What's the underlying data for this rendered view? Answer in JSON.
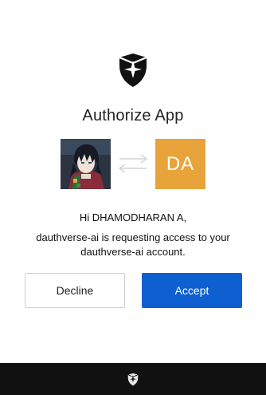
{
  "page": {
    "title": "Authorize App"
  },
  "app_avatar": {
    "icon": "anime-character-avatar"
  },
  "exchange_icon": "arrows-exchange-icon",
  "user_avatar": {
    "initials": "DA",
    "color": "#e8a43a"
  },
  "greeting": "Hi DHAMODHARAN A,",
  "message": {
    "line1": "dauthverse-ai is requesting access to your",
    "line2": "dauthverse-ai account."
  },
  "buttons": {
    "decline_label": "Decline",
    "accept_label": "Accept",
    "accept_color": "#0e5fcf"
  },
  "footer": {
    "icon": "shield-logo-icon",
    "background": "#111111"
  }
}
